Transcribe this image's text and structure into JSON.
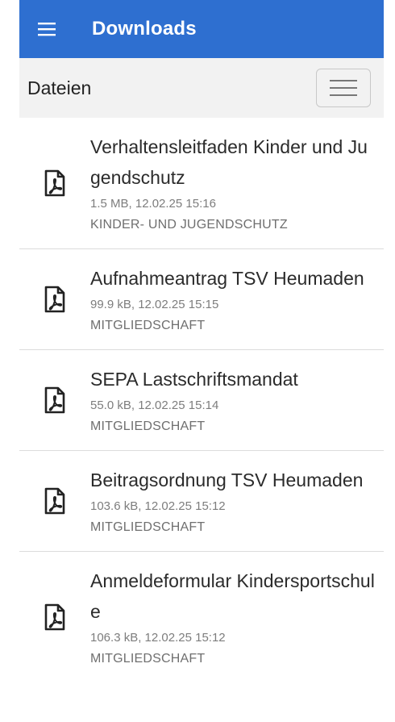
{
  "appbar": {
    "title": "Downloads",
    "menu_icon": "hamburger-menu-icon",
    "color": "#2e6fd0"
  },
  "subheader": {
    "title": "Dateien",
    "toggle_icon": "hamburger-menu-icon"
  },
  "files": [
    {
      "title": "Verhaltensleitfaden Kinder und Jugendschutz",
      "meta": "1.5 MB, 12.02.25 15:16",
      "category": "KINDER- UND JUGENDSCHUTZ",
      "icon": "pdf-file-icon"
    },
    {
      "title": "Aufnahmeantrag TSV Heumaden",
      "meta": "99.9 kB, 12.02.25 15:15",
      "category": "MITGLIEDSCHAFT",
      "icon": "pdf-file-icon"
    },
    {
      "title": "SEPA Lastschriftsmandat",
      "meta": "55.0 kB, 12.02.25 15:14",
      "category": "MITGLIEDSCHAFT",
      "icon": "pdf-file-icon"
    },
    {
      "title": "Beitragsordnung TSV Heumaden",
      "meta": "103.6 kB, 12.02.25 15:12",
      "category": "MITGLIEDSCHAFT",
      "icon": "pdf-file-icon"
    },
    {
      "title": "Anmeldeformular Kindersportschule",
      "meta": "106.3 kB, 12.02.25 15:12",
      "category": "MITGLIEDSCHAFT",
      "icon": "pdf-file-icon"
    }
  ]
}
